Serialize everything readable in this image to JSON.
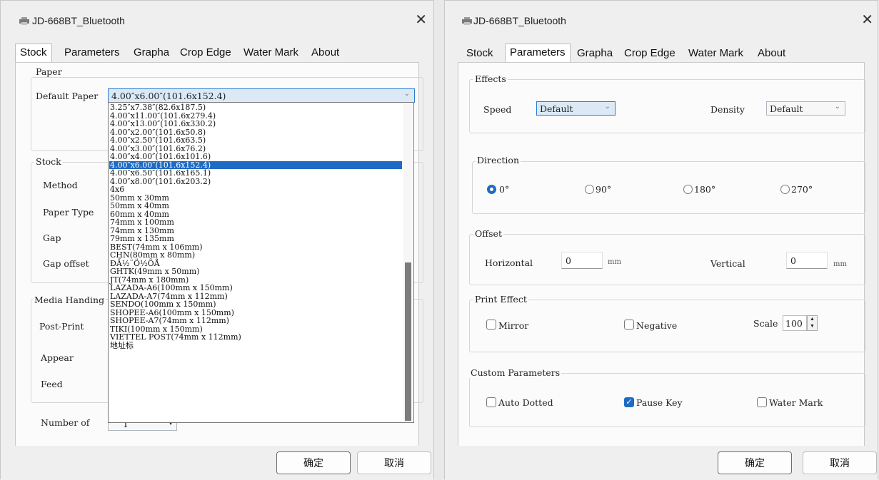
{
  "app": {
    "title": "JD-668BT_Bluetooth",
    "close_glyph": "✕"
  },
  "tabs": [
    "Stock",
    "Parameters",
    "Grapha",
    "Crop Edge",
    "Water Mark",
    "About"
  ],
  "buttons": {
    "ok": "确定",
    "cancel": "取消"
  },
  "stock": {
    "paper_group": "Paper",
    "default_paper_label": "Default Paper",
    "default_paper_value": "4.00″x6.00″(101.6x152.4)",
    "stock_group": "Stock",
    "method_label": "Method",
    "paper_type_label": "Paper Type",
    "gap_label": "Gap",
    "gap_offset_label": "Gap offset",
    "media_group": "Media Handing",
    "post_print_label": "Post-Print",
    "appear_label": "Appear",
    "feed_label": "Feed",
    "number_label": "Number of",
    "number_value": "1",
    "dropdown_options": [
      "3.25″x7.38″(82.6x187.5)",
      "4.00″x11.00″(101.6x279.4)",
      "4.00″x13.00″(101.6x330.2)",
      "4.00″x2.00″(101.6x50.8)",
      "4.00″x2.50″(101.6x63.5)",
      "4.00″x3.00″(101.6x76.2)",
      "4.00″x4.00″(101.6x101.6)",
      "4.00″x6.00″(101.6x152.4)",
      "4.00″x6.50″(101.6x165.1)",
      "4.00″x8.00″(101.6x203.2)",
      "4x6",
      "50mm x 30mm",
      "50mm x 40mm",
      "60mm x 40mm",
      "74mm x 100mm",
      "74mm x 130mm",
      "79mm x 135mm",
      "BEST(74mm x 106mm)",
      "CHN(80mm x 80mm)",
      "ĐẦ½¨Ö½ÕÅ",
      "GHTK(49mm x 50mm)",
      "JT(74mm x 180mm)",
      "LAZADA-A6(100mm x 150mm)",
      "LAZADA-A7(74mm x 112mm)",
      "SENDO(100mm x 150mm)",
      "SHOPEE-A6(100mm x 150mm)",
      "SHOPEE-A7(74mm x 112mm)",
      "TIKI(100mm x 150mm)",
      "VIETTEL POST(74mm x 112mm)",
      "地址标"
    ],
    "selected_index": 7
  },
  "params": {
    "effects_group": "Effects",
    "speed_label": "Speed",
    "speed_value": "Default",
    "density_label": "Density",
    "density_value": "Default",
    "direction_group": "Direction",
    "directions": [
      "0°",
      "90°",
      "180°",
      "270°"
    ],
    "direction_selected": 0,
    "offset_group": "Offset",
    "horizontal_label": "Horizontal",
    "horizontal_value": "0",
    "vertical_label": "Vertical",
    "vertical_value": "0",
    "unit": "mm",
    "print_effect_group": "Print Effect",
    "mirror_label": "Mirror",
    "mirror_checked": false,
    "negative_label": "Negative",
    "negative_checked": false,
    "scale_label": "Scale",
    "scale_value": "100",
    "custom_group": "Custom Parameters",
    "auto_dotted_label": "Auto Dotted",
    "auto_dotted_checked": false,
    "pause_key_label": "Pause Key",
    "pause_key_checked": true,
    "water_mark_label": "Water Mark",
    "water_mark_checked": false
  },
  "colors": {
    "accent": "#1e6bc4",
    "selection_bg": "#1e6bc4",
    "dropdown_head_bg": "#dbe9f7"
  }
}
